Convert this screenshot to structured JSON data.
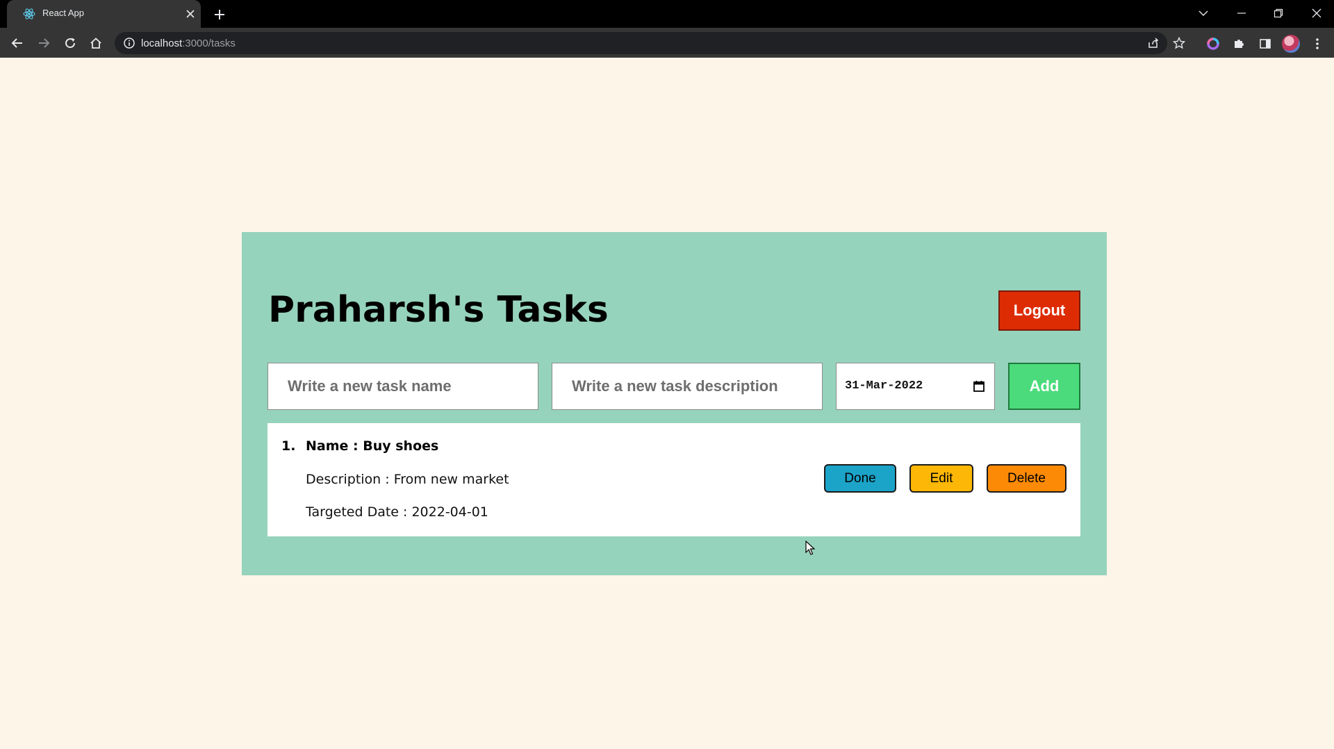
{
  "browser": {
    "tab_title": "React App",
    "url_host": "localhost",
    "url_path": ":3000/tasks"
  },
  "page": {
    "title": "Praharsh's Tasks",
    "logout_label": "Logout"
  },
  "new_task_form": {
    "name_placeholder": "Write a new task name",
    "description_placeholder": "Write a new task description",
    "date_value": "31-Mar-2022",
    "add_label": "Add"
  },
  "tasks": [
    {
      "number": "1.",
      "name": "Name : Buy shoes",
      "description": "Description : From new market",
      "targeted_date": "Targeted Date : 2022-04-01",
      "actions": {
        "done_label": "Done",
        "edit_label": "Edit",
        "delete_label": "Delete"
      }
    }
  ],
  "colors": {
    "page_background": "#fdf5e8",
    "card_background": "#96d3bd",
    "logout": "#dd2c04",
    "add": "#4bdb7c",
    "done": "#1ca3c8",
    "edit": "#fcb707",
    "delete": "#fc8a06"
  },
  "icons": {
    "tab_favicon": "react-icon",
    "tab_close": "close-icon",
    "new_tab": "plus-icon",
    "back": "arrow-left-icon",
    "forward": "arrow-right-icon",
    "reload": "reload-icon",
    "home": "home-icon",
    "site_info": "info-icon",
    "share": "share-icon",
    "bookmark": "star-icon",
    "extensions": "puzzle-icon",
    "side_panel": "side-panel-icon",
    "menu": "kebab-menu-icon",
    "date_picker": "calendar-icon"
  }
}
